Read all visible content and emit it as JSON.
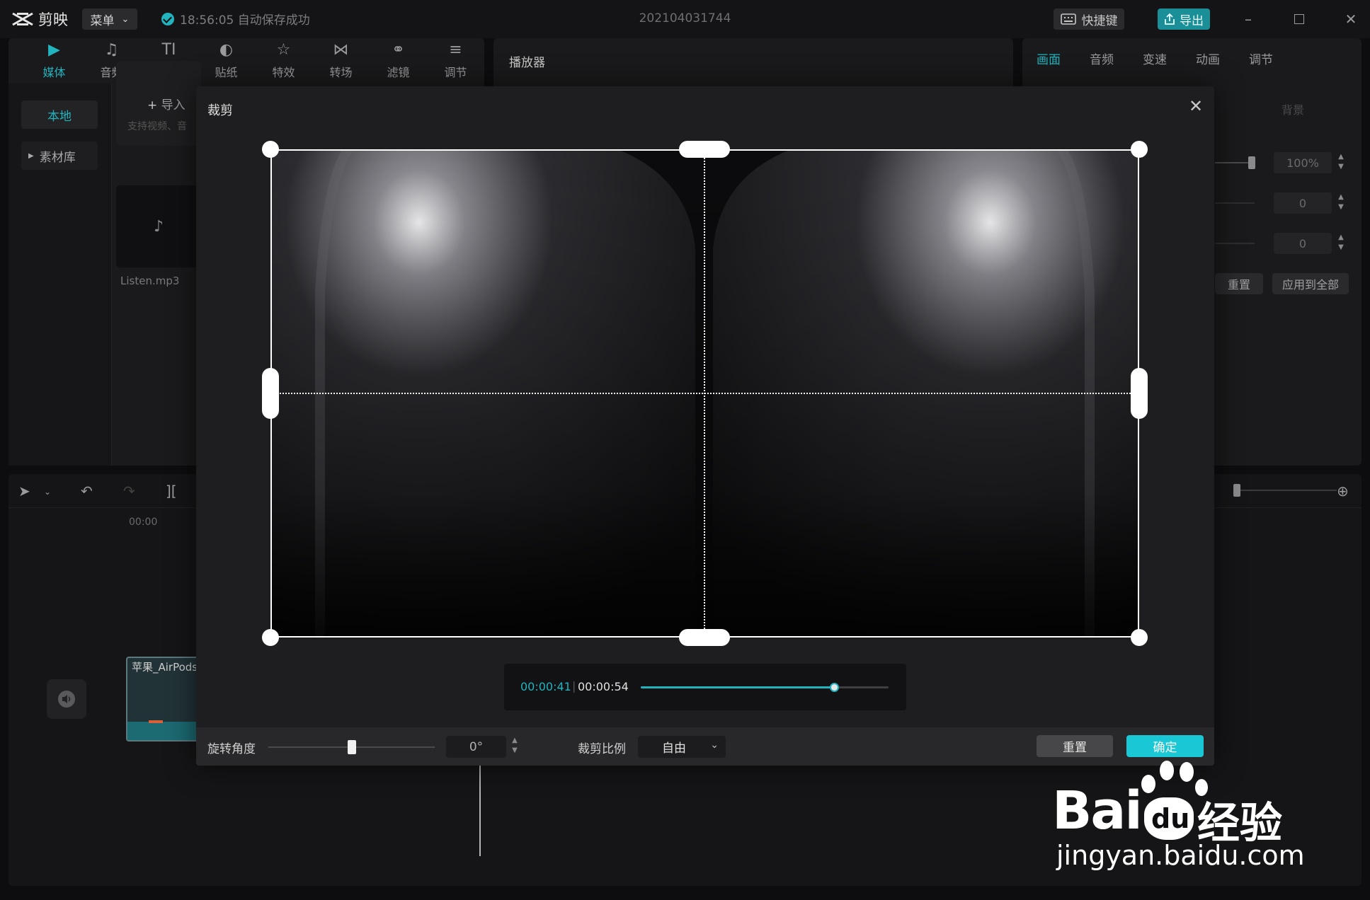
{
  "app": {
    "logo_text": "剪映",
    "menu_label": "菜单",
    "autosave_text": "18:56:05 自动保存成功",
    "project_name": "202104031744",
    "shortcut_label": "快捷键",
    "export_label": "导出"
  },
  "media_panel": {
    "tabs": [
      {
        "label": "媒体",
        "icon": "media-icon"
      },
      {
        "label": "音频",
        "icon": "audio-icon"
      },
      {
        "label": "文本",
        "icon": "text-icon"
      },
      {
        "label": "贴纸",
        "icon": "sticker-icon"
      },
      {
        "label": "特效",
        "icon": "effects-icon"
      },
      {
        "label": "转场",
        "icon": "transition-icon"
      },
      {
        "label": "滤镜",
        "icon": "filter-icon"
      },
      {
        "label": "调节",
        "icon": "adjust-icon"
      }
    ],
    "active_tab": "媒体",
    "side_local": "本地",
    "side_library": "素材库",
    "import_label": "导入",
    "import_hint": "支持视频、音",
    "file_name": "Listen.mp3"
  },
  "player": {
    "title": "播放器"
  },
  "props_panel": {
    "tabs": [
      "画面",
      "音频",
      "变速",
      "动画",
      "调节"
    ],
    "active_tab": "画面",
    "background_label": "背景",
    "scale_value": "100%",
    "pos_x_value": "0",
    "pos_y_value": "0",
    "reset_label": "重置",
    "apply_all_label": "应用到全部"
  },
  "timeline": {
    "time_mark": "00:00",
    "clip_label": "苹果_AirPods"
  },
  "crop_dialog": {
    "title": "裁剪",
    "current_time": "00:00:41",
    "total_time": "00:00:54",
    "seek_progress": 0.78,
    "rotation_label": "旋转角度",
    "rotation_value": "0°",
    "rotation_slider": 0.5,
    "ratio_label": "裁剪比例",
    "ratio_value": "自由",
    "reset_label": "重置",
    "confirm_label": "确定"
  },
  "watermark": {
    "brand": "Bai",
    "brand_cn": "经验",
    "url": "jingyan.baidu.com"
  },
  "colors": {
    "accent": "#21b3be",
    "confirm": "#19c8d4"
  }
}
